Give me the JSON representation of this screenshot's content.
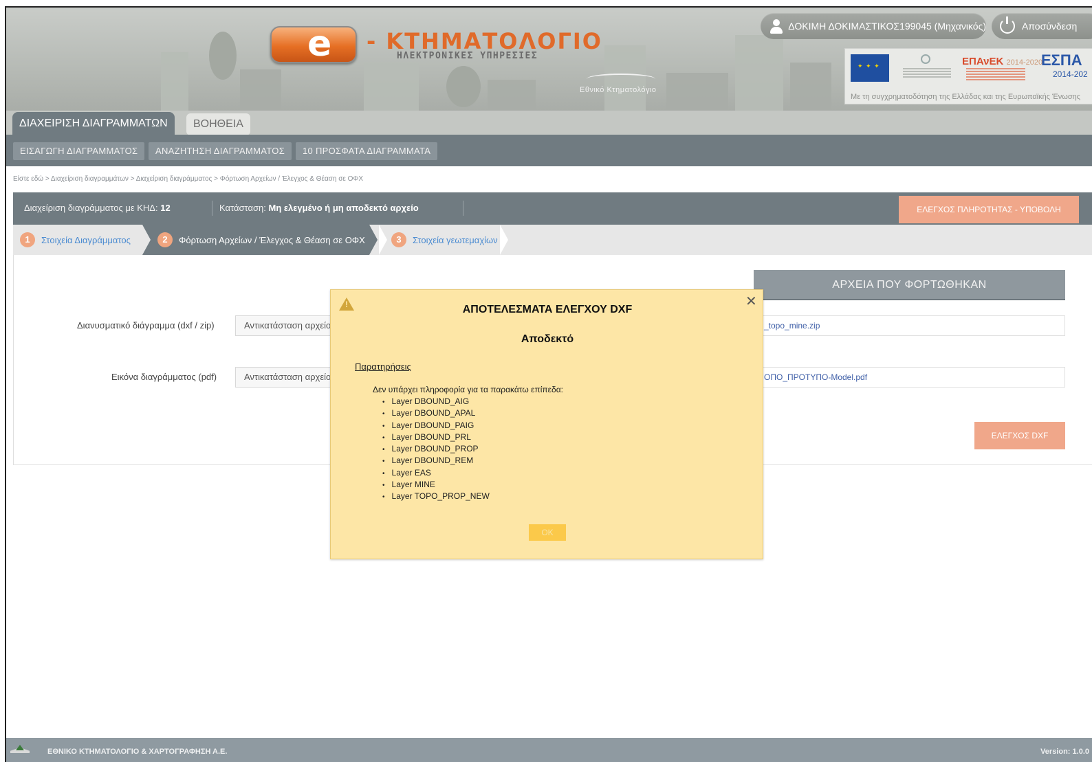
{
  "header": {
    "logo_letter": "e",
    "logo_title": "- ΚΤΗΜΑΤΟΛΟΓΙΟ",
    "logo_subtitle": "ΗΛΕΚΤΡΟΝΙΚΕΣ ΥΠΗΡΕΣΙΕΣ",
    "org_logo_text": "Εθνικό Κτηματολόγιο",
    "user_label": "ΔΟΚΙΜΗ ΔΟΚΙΜΑΣΤΙΚΟΣ199045 (Μηχανικός)",
    "logout_label": "Αποσύνδεση",
    "eu_funding": {
      "epanek": "ΕΠΑνΕΚ",
      "epanek_years": "2014-2020",
      "espa": "ΕΣΠΑ",
      "espa_years": "2014-202",
      "caption": "Με τη συγχρηματοδότηση της Ελλάδας και της Ευρωπαϊκής Ένωσης"
    }
  },
  "nav": {
    "tabs": [
      {
        "label": "ΔΙΑΧΕΙΡΙΣΗ ΔΙΑΓΡΑΜΜΑΤΩΝ",
        "active": true
      },
      {
        "label": "ΒΟΗΘΕΙΑ",
        "active": false
      }
    ],
    "subnav": [
      "ΕΙΣΑΓΩΓΗ ΔΙΑΓΡΑΜΜΑΤΟΣ",
      "ΑΝΑΖΗΤΗΣΗ ΔΙΑΓΡΑΜΜΑΤΟΣ",
      "10 ΠΡΟΣΦΑΤΑ ΔΙΑΓΡΑΜΜΑΤΑ"
    ]
  },
  "breadcrumb": "Είστε εδώ > Διαχείριση διαγραμμάτων > Διαχείριση διαγράμματος > Φόρτωση Αρχείων / Έλεγχος & Θέαση σε ΟΦΧ",
  "diagram_bar": {
    "manage_label": "Διαχείριση διαγράμματος με ΚΗΔ:",
    "khd_value": "12",
    "status_label": "Κατάσταση:",
    "status_value": "Μη ελεγμένο ή μη αποδεκτό αρχείο",
    "submit_button": "ΕΛΕΓΧΟΣ ΠΛΗΡΟΤΗΤΑΣ - ΥΠΟΒΟΛΗ"
  },
  "steps": [
    {
      "num": "1",
      "label": "Στοιχεία Διαγράμματος",
      "active": false
    },
    {
      "num": "2",
      "label": "Φόρτωση Αρχείων / Έλεγχος & Θέαση σε ΟΦΧ",
      "active": true
    },
    {
      "num": "3",
      "label": "Στοιχεία γεωτεμαχίων",
      "active": false
    }
  ],
  "form": {
    "vector_label": "Διανυσματικό διάγραμμα (dxf / zip)",
    "vector_button": "Αντικατάσταση αρχείου",
    "image_label": "Εικόνα διαγράμματος (pdf)",
    "image_button": "Αντικατάσταση αρχείου",
    "uploaded_heading": "ΑΡΧΕΙΑ ΠΟΥ ΦΟΡΤΩΘΗΚΑΝ",
    "uploaded_files": [
      "_topo_mine.zip",
      "ΟΠΟ_ΠΡΟΤΥΠΟ-Model.pdf"
    ],
    "check_dxf_button": "ΕΛΕΓΧΟΣ DXF"
  },
  "modal": {
    "title": "ΑΠΟΤΕΛΕΣΜΑΤΑ ΕΛΕΓΧΟΥ DXF",
    "result": "Αποδεκτό",
    "notes_heading": "Παρατηρήσεις",
    "intro": "Δεν υπάρχει πληροφορία για τα παρακάτω επίπεδα:",
    "layers": [
      "Layer DBOUND_AIG",
      "Layer DBOUND_APAL",
      "Layer DBOUND_PAIG",
      "Layer DBOUND_PRL",
      "Layer DBOUND_PROP",
      "Layer DBOUND_REM",
      "Layer EAS",
      "Layer MINE",
      "Layer TOPO_PROP_NEW"
    ],
    "ok_button": "OK",
    "close_glyph": "✕"
  },
  "footer": {
    "org": "ΕΘΝΙΚΟ ΚΤΗΜΑΤΟΛΟΓΙΟ & ΧΑΡΤΟΓΡΑΦΗΣΗ Α.Ε.",
    "version": "Version: 1.0.0"
  },
  "colors": {
    "nav_gray": "#707b81",
    "accent_orange": "#f0a78a",
    "modal_bg": "#fde6a6",
    "link_blue": "#4a8bd1"
  }
}
